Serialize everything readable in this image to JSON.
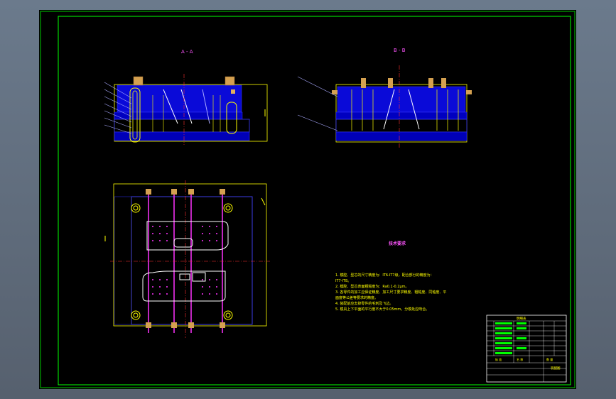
{
  "viewport": {
    "background": "#000000",
    "frame_color": "#00ff00",
    "line_color": "#0000ff",
    "section_color": "#ffff00",
    "accent_color": "#ff00ff",
    "center_color": "#ff0000"
  },
  "views": {
    "section_aa_label": "A - A",
    "section_bb_label": "B - B"
  },
  "notes": {
    "title": "技术要求",
    "lines": [
      "1. 模腔、型芯的尺寸精度为：IT6-IT7级，配合部分的精度为：",
      "IT7-IT8。",
      "2. 模腔、型芯表面粗糙度为：Ra0.1-0.2μm。",
      "3. 各零件的加工应保证精度、加工尺寸要求精度、粗糙度、同轴度、平",
      "面度等公差等要求的精度。",
      "4. 装配前应去掉零件的毛刺及飞边。",
      "5. 模具上下平面的平行度不大于0.05mm，分模处应吻合。"
    ]
  },
  "title_block": {
    "header": "明细表",
    "label_left": "标 准",
    "label_mid": "名 称",
    "label_right": "数 量",
    "footer": "装配图"
  }
}
